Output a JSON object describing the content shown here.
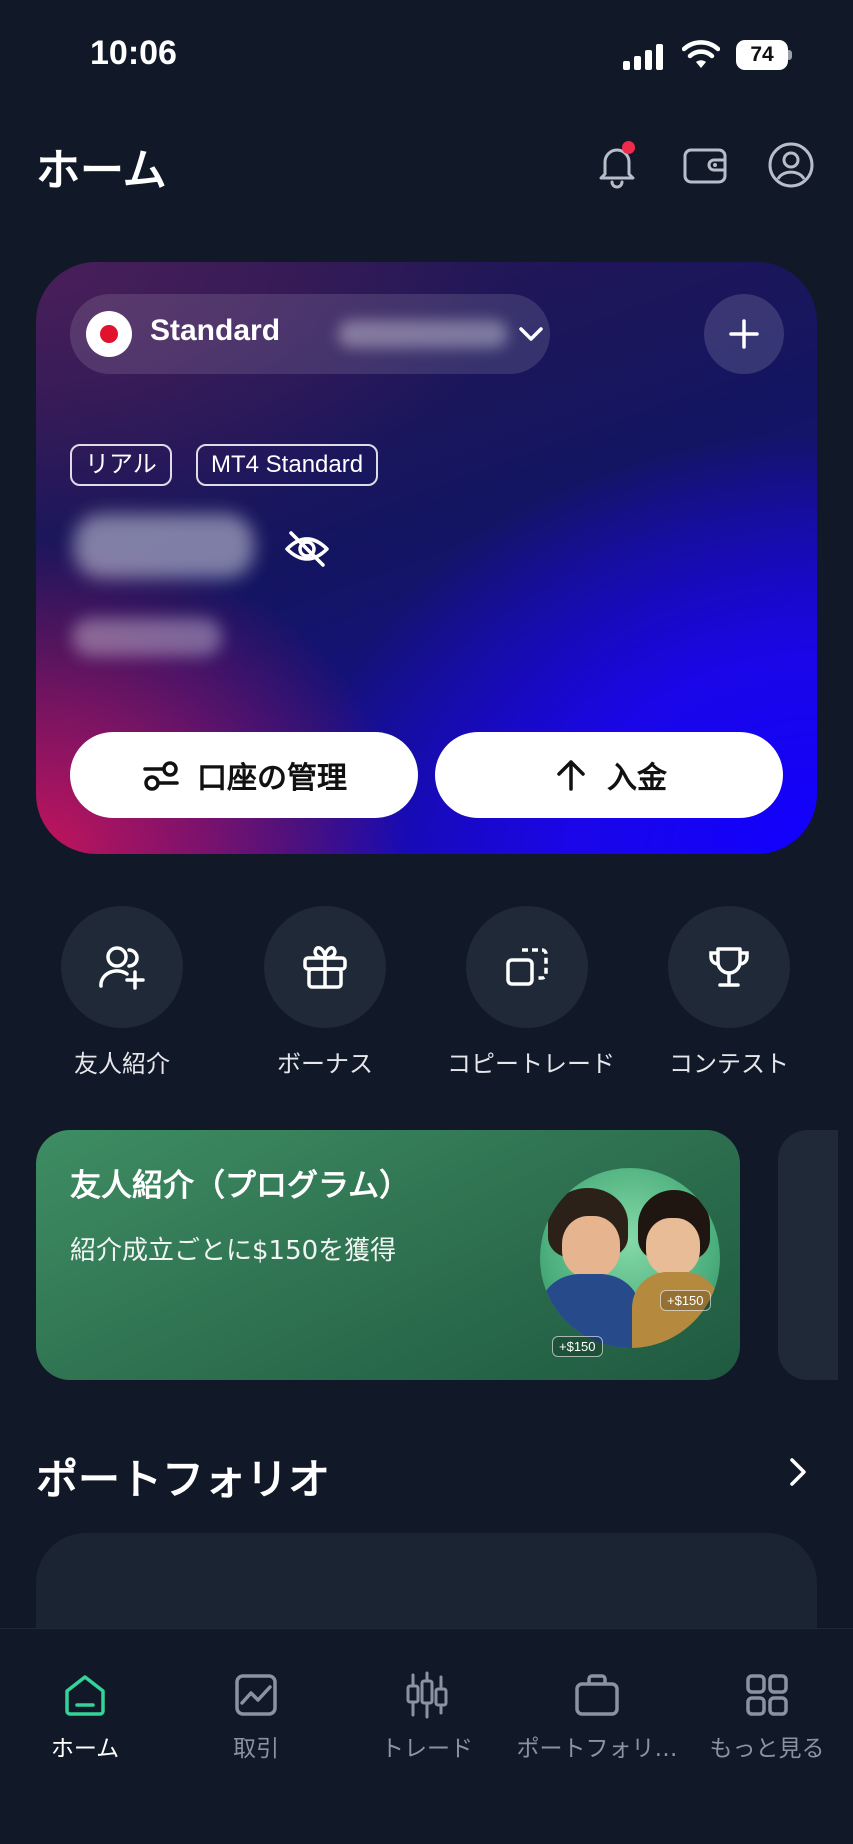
{
  "status_bar": {
    "time": "10:06",
    "battery": "74"
  },
  "header": {
    "title": "ホーム"
  },
  "account_card": {
    "account_type": "Standard",
    "tags": [
      "リアル",
      "MT4 Standard"
    ],
    "manage_button": "口座の管理",
    "deposit_button": "入金"
  },
  "quick_actions": [
    {
      "label": "友人紹介",
      "icon": "add-user-icon"
    },
    {
      "label": "ボーナス",
      "icon": "gift-icon"
    },
    {
      "label": "コピートレード",
      "icon": "copy-icon"
    },
    {
      "label": "コンテスト",
      "icon": "trophy-icon"
    }
  ],
  "promo": {
    "title": "友人紹介（プログラム）",
    "description": "紹介成立ごとに$150を獲得",
    "chip_1": "+$150",
    "chip_2": "+$150"
  },
  "portfolio": {
    "title": "ポートフォリオ"
  },
  "bottom_nav": {
    "active": "ホーム",
    "items": [
      {
        "label": "ホーム",
        "icon": "home-icon"
      },
      {
        "label": "取引",
        "icon": "chart-icon"
      },
      {
        "label": "トレード",
        "icon": "candlestick-icon"
      },
      {
        "label": "ポートフォリ…",
        "icon": "briefcase-icon"
      },
      {
        "label": "もっと見る",
        "icon": "grid-icon"
      }
    ]
  },
  "colors": {
    "background": "#111827",
    "accent_green": "#34d399",
    "notification_red": "#ef2b4c",
    "promo_green": "#3e8d63"
  }
}
